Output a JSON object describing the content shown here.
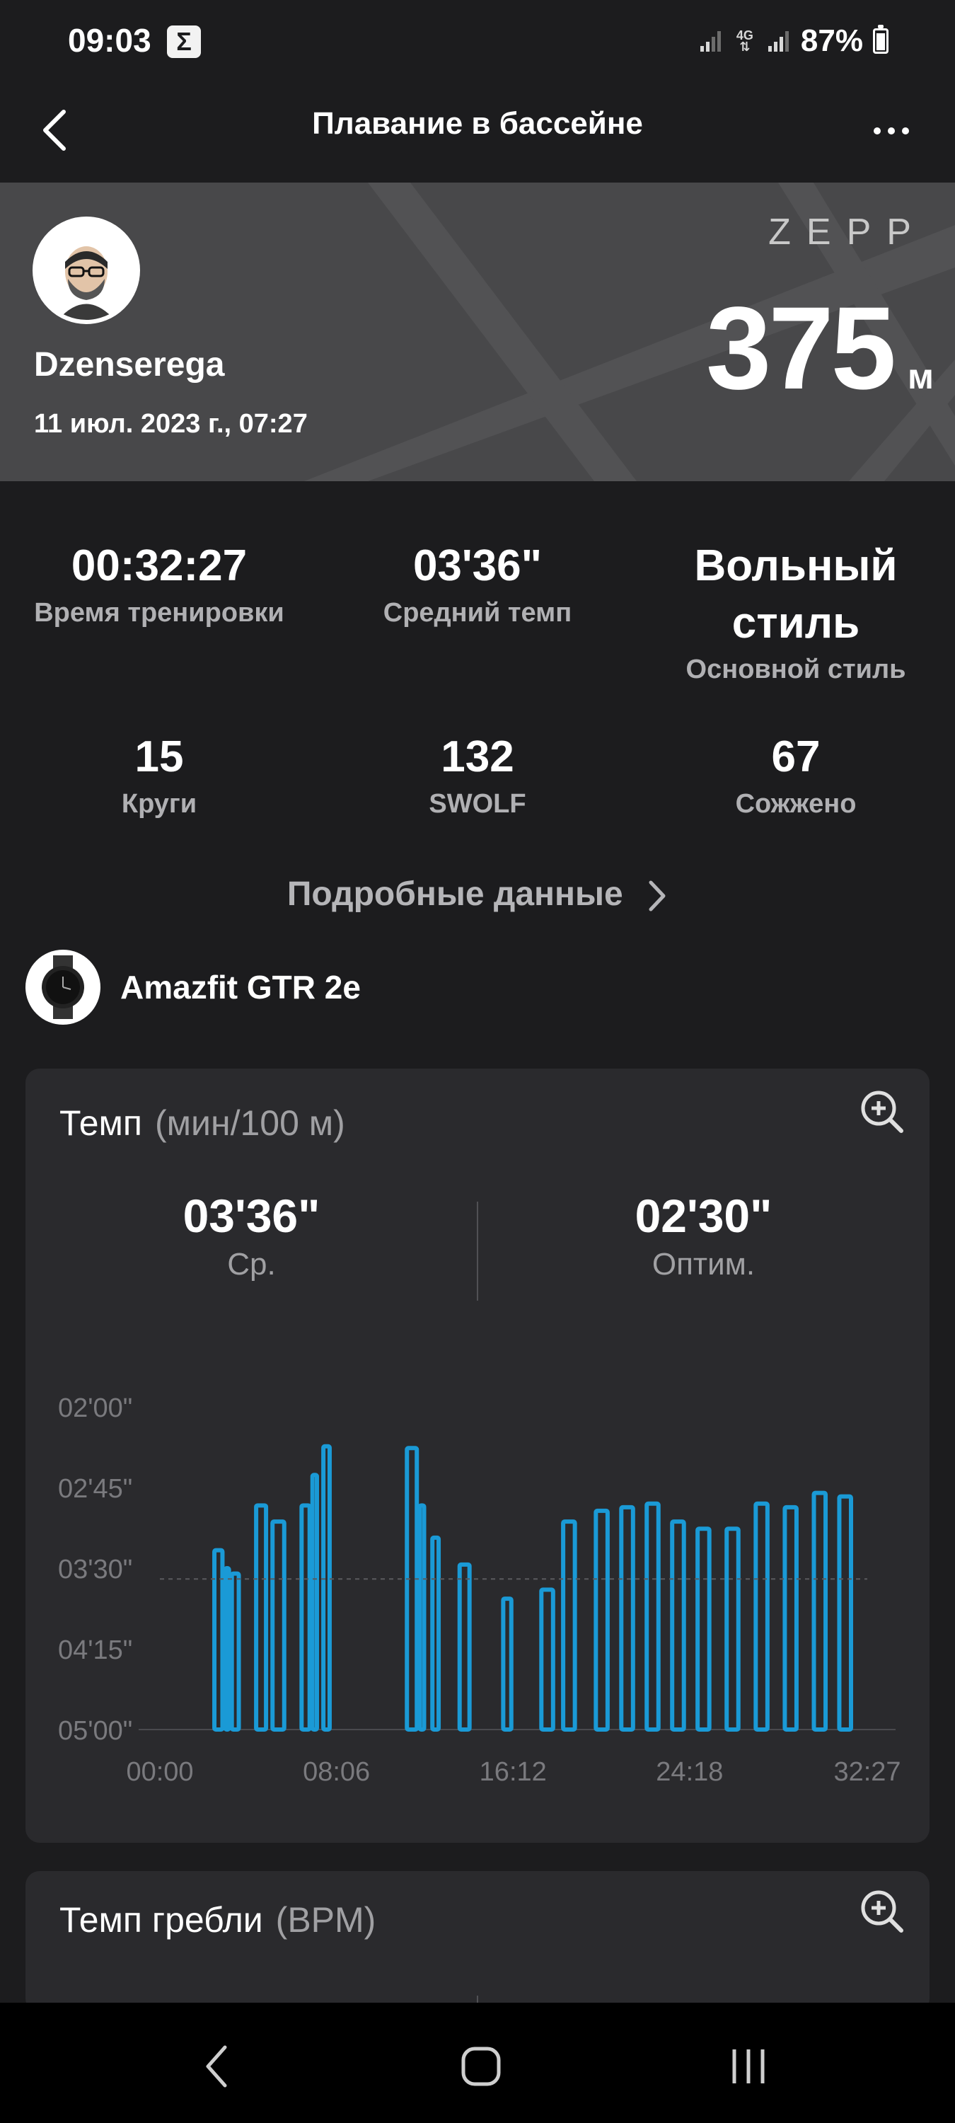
{
  "status_bar": {
    "time": "09:03",
    "s_badge": "Σ",
    "network": "4G",
    "battery": "87%"
  },
  "header": {
    "title": "Плавание в бассейне",
    "back_icon": "chevron-left-icon",
    "more_icon": "more-horizontal-icon"
  },
  "banner": {
    "username": "Dzenserega",
    "date": "11 июл. 2023 г., 07:27",
    "brand": "ZEPP",
    "distance_value": "375",
    "distance_unit": "м"
  },
  "stats": [
    {
      "value": "00:32:27",
      "label": "Время тренировки"
    },
    {
      "value": "03'36\"",
      "label": "Средний темп"
    },
    {
      "value": "Вольный стиль",
      "label": "Основной стиль"
    },
    {
      "value": "15",
      "label": "Круги"
    },
    {
      "value": "132",
      "label": "SWOLF"
    },
    {
      "value": "67",
      "label": "Сожжено"
    }
  ],
  "details_link": "Подробные данные",
  "device": {
    "name": "Amazfit GTR 2e",
    "icon": "watch-icon"
  },
  "pace_card": {
    "title": "Темп",
    "unit": "(мин/100 м)",
    "zoom_icon": "zoom-in-icon",
    "avg_value": "03'36\"",
    "avg_label": "Ср.",
    "best_value": "02'30\"",
    "best_label": "Оптим."
  },
  "stroke_card": {
    "title": "Темп гребли",
    "unit": "(BPM)",
    "zoom_icon": "zoom-in-icon"
  },
  "chart_data": {
    "type": "bar",
    "title": "",
    "xlabel": "",
    "ylabel": "",
    "color": "#1a9ad6",
    "average_line": 216,
    "y_inverted": true,
    "yticks": [
      "02'00\"",
      "02'45\"",
      "03'30\"",
      "04'15\"",
      "05'00\""
    ],
    "ytick_values": [
      120,
      165,
      210,
      255,
      300
    ],
    "xticks": [
      "00:00",
      "08:06",
      "16:12",
      "24:18",
      "32:27"
    ],
    "xtick_values": [
      0,
      486,
      972,
      1458,
      1947
    ],
    "ylim": [
      120,
      300
    ],
    "xlim": [
      0,
      1947
    ],
    "segments": [
      {
        "start": 150,
        "end": 180,
        "value": 200
      },
      {
        "start": 180,
        "end": 198,
        "value": 210
      },
      {
        "start": 198,
        "end": 225,
        "value": 213
      },
      {
        "start": 265,
        "end": 300,
        "value": 175
      },
      {
        "start": 310,
        "end": 350,
        "value": 184
      },
      {
        "start": 390,
        "end": 420,
        "value": 175
      },
      {
        "start": 420,
        "end": 440,
        "value": 158
      },
      {
        "start": 450,
        "end": 475,
        "value": 142
      },
      {
        "start": 680,
        "end": 715,
        "value": 143
      },
      {
        "start": 715,
        "end": 735,
        "value": 175
      },
      {
        "start": 750,
        "end": 775,
        "value": 193
      },
      {
        "start": 825,
        "end": 860,
        "value": 208
      },
      {
        "start": 945,
        "end": 975,
        "value": 227
      },
      {
        "start": 1050,
        "end": 1090,
        "value": 222
      },
      {
        "start": 1110,
        "end": 1150,
        "value": 184
      },
      {
        "start": 1200,
        "end": 1240,
        "value": 178
      },
      {
        "start": 1270,
        "end": 1310,
        "value": 176
      },
      {
        "start": 1340,
        "end": 1380,
        "value": 174
      },
      {
        "start": 1410,
        "end": 1450,
        "value": 184
      },
      {
        "start": 1480,
        "end": 1520,
        "value": 188
      },
      {
        "start": 1560,
        "end": 1600,
        "value": 188
      },
      {
        "start": 1640,
        "end": 1680,
        "value": 174
      },
      {
        "start": 1720,
        "end": 1760,
        "value": 176
      },
      {
        "start": 1800,
        "end": 1840,
        "value": 168
      },
      {
        "start": 1870,
        "end": 1910,
        "value": 170
      }
    ]
  }
}
